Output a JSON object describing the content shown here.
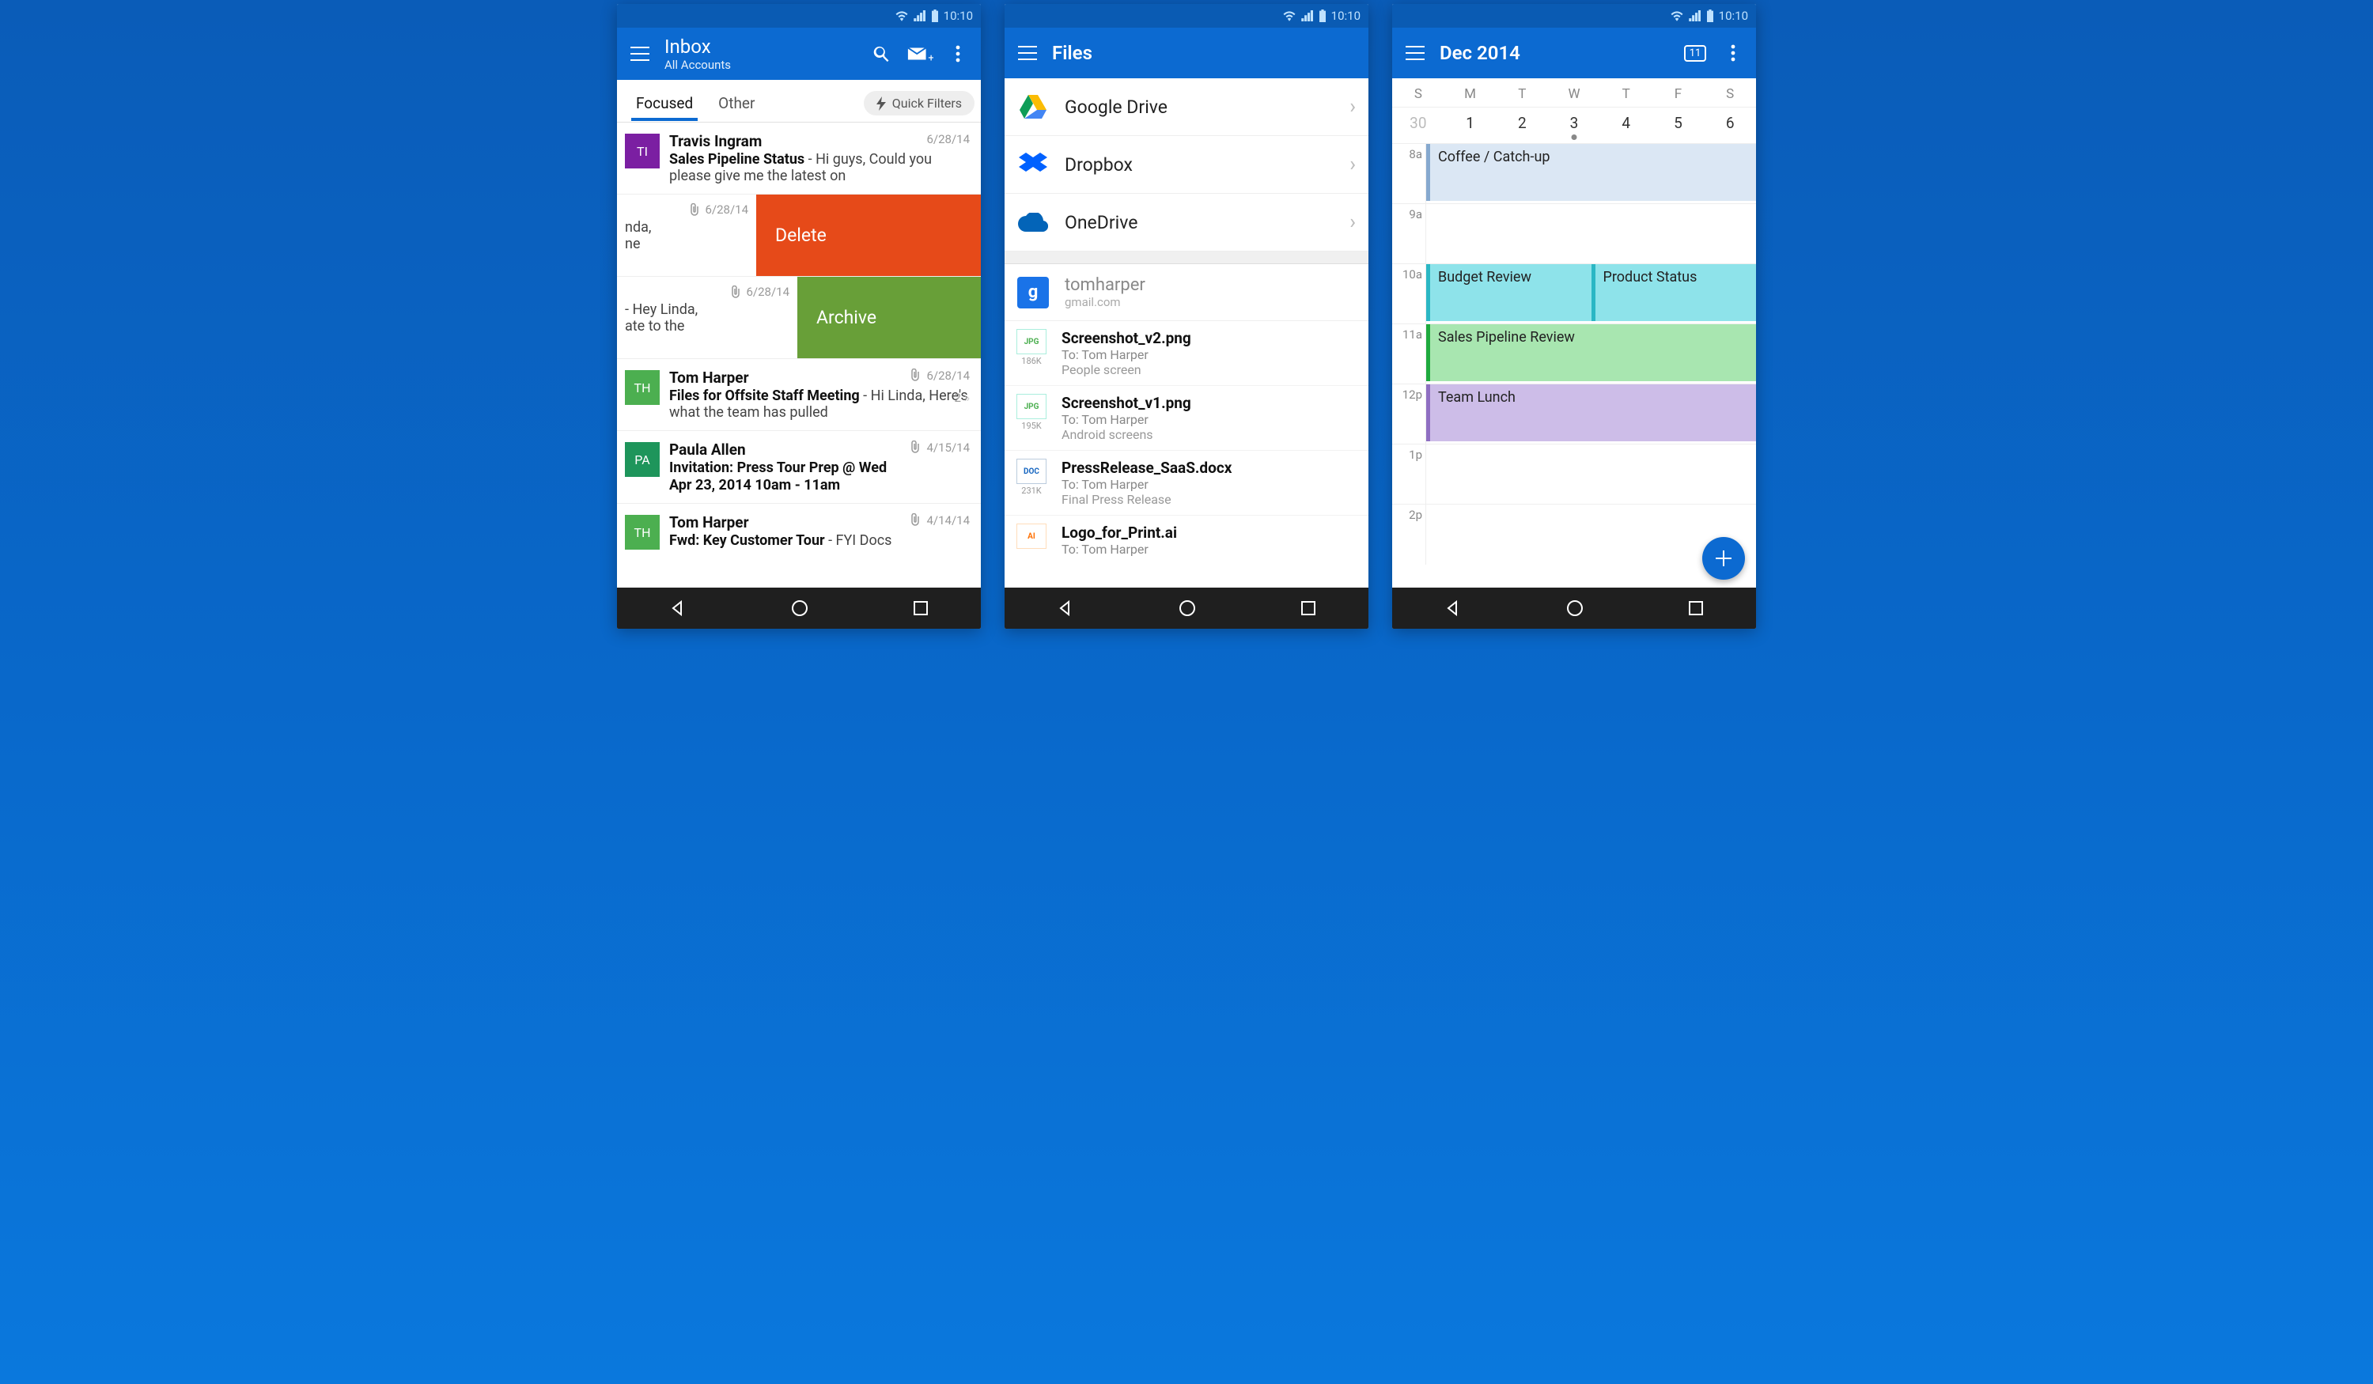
{
  "statusbar": {
    "time": "10:10"
  },
  "mail": {
    "title": "Inbox",
    "subtitle": "All Accounts",
    "tabs": {
      "focused": "Focused",
      "other": "Other",
      "quick": "Quick Filters"
    },
    "rows": [
      {
        "initials": "TI",
        "sender": "Travis Ingram",
        "subject": "Sales Pipeline Status",
        "preview": " - Hi guys, Could you please give me the latest on",
        "date": "6/28/14",
        "avatarColor": "#7b1fa2"
      }
    ],
    "swipeA": {
      "label": "Delete",
      "date": "6/28/14",
      "frag1": "nda,",
      "frag2": "ne"
    },
    "swipeB": {
      "label": "Archive",
      "date": "6/28/14",
      "frag1": " - Hey Linda,",
      "frag2": "ate to the"
    },
    "rowC": {
      "initials": "TH",
      "sender": "Tom Harper",
      "subject": "Files for Offsite Staff Meeting",
      "preview": " - Hi Linda, Here's what the team has pulled",
      "date": "6/28/14",
      "count": "2",
      "avatarColor": "#4caf50"
    },
    "rowD": {
      "initials": "PA",
      "sender": "Paula Allen",
      "line1": "Invitation: Press Tour Prep @ Wed",
      "line2": "Apr 23, 2014 10am - 11am",
      "date": "4/15/14",
      "avatarColor": "#1e955b"
    },
    "rowE": {
      "initials": "TH",
      "sender": "Tom Harper",
      "subject": "Fwd: Key Customer Tour",
      "preview": " - FYI  Docs",
      "date": "4/14/14",
      "avatarColor": "#4caf50"
    }
  },
  "files": {
    "title": "Files",
    "services": [
      {
        "name": "Google Drive"
      },
      {
        "name": "Dropbox"
      },
      {
        "name": "OneDrive"
      }
    ],
    "account": {
      "name": "tomharper",
      "domain": "gmail.com"
    },
    "items": [
      {
        "name": "Screenshot_v2.png",
        "to": "To: Tom Harper",
        "desc": "People screen",
        "size": "186K",
        "type": "JPG"
      },
      {
        "name": "Screenshot_v1.png",
        "to": "To: Tom Harper",
        "desc": "Android screens",
        "size": "195K",
        "type": "JPG"
      },
      {
        "name": "PressRelease_SaaS.docx",
        "to": "To: Tom Harper",
        "desc": "Final Press Release",
        "size": "231K",
        "type": "DOC"
      },
      {
        "name": "Logo_for_Print.ai",
        "to": "To: Tom Harper",
        "desc": "",
        "size": "",
        "type": "AI"
      }
    ]
  },
  "cal": {
    "title": "Dec 2014",
    "today": "11",
    "dow": [
      "S",
      "M",
      "T",
      "W",
      "T",
      "F",
      "S"
    ],
    "nums": [
      "30",
      "1",
      "2",
      "3",
      "4",
      "5",
      "6"
    ],
    "hours": [
      "8a",
      "9a",
      "10a",
      "11a",
      "12p",
      "1p",
      "2p"
    ],
    "events": {
      "coffee": "Coffee / Catch-up",
      "budget": "Budget Review",
      "product": "Product Status",
      "pipeline": "Sales Pipeline Review",
      "lunch": "Team Lunch"
    }
  }
}
